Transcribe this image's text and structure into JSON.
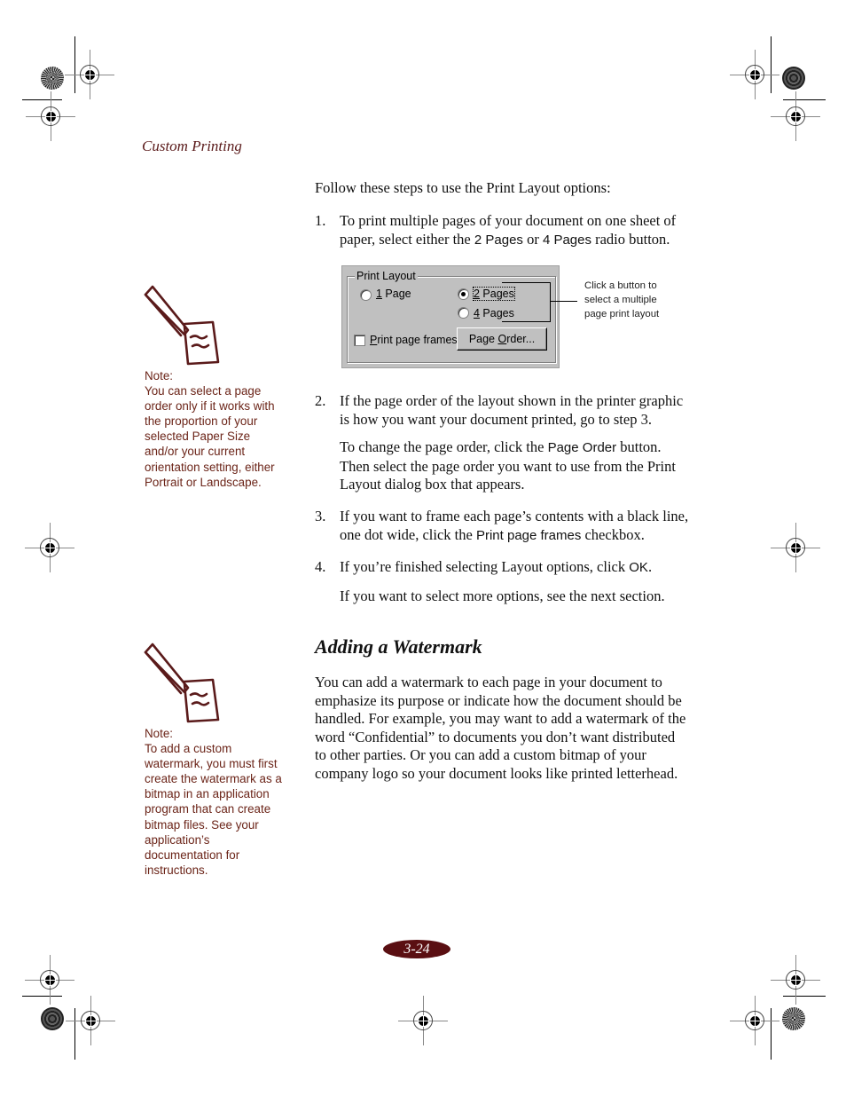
{
  "running_head": "Custom Printing",
  "intro": "Follow these steps to use the Print Layout options:",
  "steps": [
    {
      "num": "1.",
      "lines": [
        {
          "pre": "To print multiple pages of your document on one sheet of",
          "term": "",
          "post": ""
        },
        {
          "pre": "paper, select either the ",
          "term": "2 Pages",
          "mid": " or ",
          "term2": "4 Pages",
          "post": " radio button."
        }
      ]
    },
    {
      "num": "2.",
      "lines": [
        {
          "pre": "If the page order of the layout shown in the printer graphic"
        },
        {
          "pre": "is how you want your document printed, go to step 3."
        }
      ],
      "para": [
        {
          "pre": "To change the page order, click the ",
          "term": "Page Order",
          "post": " button."
        },
        {
          "pre": "Then select the page order you want to use from the Print"
        },
        {
          "pre": "Layout dialog box that appears."
        }
      ]
    },
    {
      "num": "3.",
      "lines": [
        {
          "pre": "If you want to frame each page’s contents with a black line,"
        },
        {
          "pre": "one dot wide, click the ",
          "term": "Print page frames",
          "post": " checkbox."
        }
      ]
    },
    {
      "num": "4.",
      "lines": [
        {
          "pre": "If you’re finished selecting Layout options, click ",
          "term": "OK",
          "post": "."
        }
      ],
      "para": [
        {
          "pre": "If you want to select more options, see the next section."
        }
      ]
    }
  ],
  "dialog": {
    "group_title": "Print Layout",
    "radio_1": {
      "label_ul": "1",
      "label_rest": " Page",
      "checked": false
    },
    "radio_2": {
      "label_ul": "2",
      "label_rest": " Pages",
      "checked": true
    },
    "radio_4": {
      "label_ul": "4",
      "label_rest": " Pages",
      "checked": false
    },
    "checkbox": {
      "label_ul": "P",
      "label_rest": "rint page frames",
      "checked": false
    },
    "button": {
      "label_pre": "Page ",
      "label_ul": "O",
      "label_post": "rder..."
    }
  },
  "callout": [
    "Click a button to",
    "select a multiple",
    "page print layout"
  ],
  "notes": [
    {
      "title": "Note:",
      "lines": [
        "You can select a page",
        "order only if it works with",
        "the proportion of your",
        "selected Paper Size",
        "and/or your current",
        "orientation setting, either",
        "Portrait or Landscape."
      ]
    },
    {
      "title": "Note:",
      "lines": [
        "To add a custom",
        "watermark, you must first",
        "create the watermark as a",
        "bitmap in an application",
        "program that can create",
        "bitmap files. See your",
        "application’s",
        "documentation for",
        "instructions."
      ]
    }
  ],
  "section": {
    "title": "Adding a Watermark",
    "lines": [
      "You can add a watermark to each page in your document to",
      "emphasize its purpose or indicate how the document should be",
      "handled. For example, you may want to add a watermark of the",
      "word “Confidential” to documents you don’t want distributed",
      "to other parties. Or you can add a custom bitmap of your",
      "company logo so your document looks like printed letterhead."
    ]
  },
  "page_number": "3-24",
  "colors": {
    "accent": "#5a0f12",
    "note_text": "#6b2418",
    "dialog_bg": "#c0c0c0"
  }
}
